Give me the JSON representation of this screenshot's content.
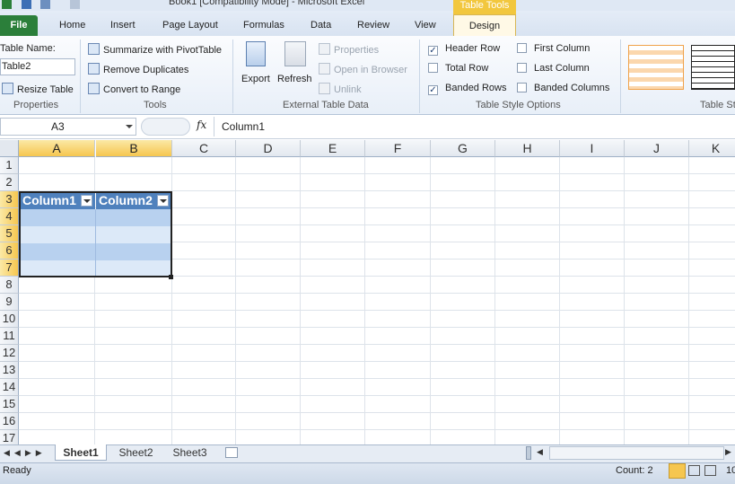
{
  "window": {
    "title": "Book1 [Compatibility Mode] - Microsoft Excel"
  },
  "contextual": {
    "group": "Table Tools"
  },
  "tabs": {
    "file": "File",
    "home": "Home",
    "insert": "Insert",
    "page_layout": "Page Layout",
    "formulas": "Formulas",
    "data": "Data",
    "review": "Review",
    "view": "View",
    "design": "Design"
  },
  "ribbon": {
    "properties": {
      "table_name_label": "Table Name:",
      "table_name_value": "Table2",
      "resize": "Resize Table",
      "group": "Properties"
    },
    "tools": {
      "pivot": "Summarize with PivotTable",
      "remove_dup": "Remove Duplicates",
      "convert": "Convert to Range",
      "group": "Tools"
    },
    "external": {
      "export": "Export",
      "refresh": "Refresh",
      "properties": "Properties",
      "open_browser": "Open in Browser",
      "unlink": "Unlink",
      "group": "External Table Data"
    },
    "options": {
      "header_row": "Header Row",
      "total_row": "Total Row",
      "banded_rows": "Banded Rows",
      "first_column": "First Column",
      "last_column": "Last Column",
      "banded_columns": "Banded Columns",
      "checked": {
        "header_row": true,
        "total_row": false,
        "banded_rows": true,
        "first_column": false,
        "last_column": false,
        "banded_columns": false
      },
      "group": "Table Style Options"
    },
    "styles": {
      "group": "Table St"
    }
  },
  "formula_bar": {
    "name_box": "A3",
    "fx": "fx",
    "content": "Column1"
  },
  "grid": {
    "columns": [
      "A",
      "B",
      "C",
      "D",
      "E",
      "F",
      "G",
      "H",
      "I",
      "J",
      "K"
    ],
    "rows": [
      "1",
      "2",
      "3",
      "4",
      "5",
      "6",
      "7",
      "8",
      "9",
      "10",
      "11",
      "12",
      "13",
      "14",
      "15",
      "16",
      "17"
    ],
    "table": {
      "headers": [
        "Column1",
        "Column2"
      ]
    }
  },
  "sheets": [
    "Sheet1",
    "Sheet2",
    "Sheet3"
  ],
  "status": {
    "ready": "Ready",
    "count": "Count: 2",
    "zoom_partial": "10"
  },
  "colors": {
    "table_header": "#4f81bd",
    "band_dark": "#b8d1ef",
    "band_light": "#dce9f8",
    "file_tab": "#2b7f3a",
    "context_tab": "#f2c73e"
  }
}
